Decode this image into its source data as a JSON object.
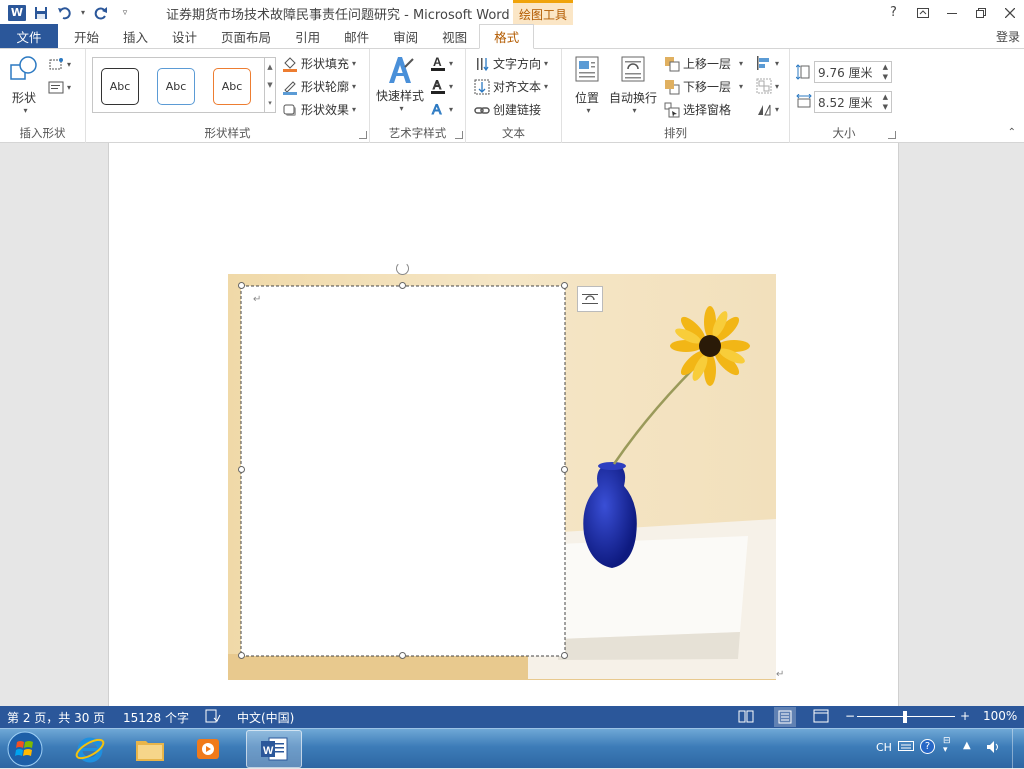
{
  "window": {
    "title": "证券期货市场技术故障民事责任问题研究 - Microsoft Word",
    "context_tab": "绘图工具",
    "login": "登录",
    "help": "?"
  },
  "tabs": [
    {
      "label": "文件"
    },
    {
      "label": "开始"
    },
    {
      "label": "插入"
    },
    {
      "label": "设计"
    },
    {
      "label": "页面布局"
    },
    {
      "label": "引用"
    },
    {
      "label": "邮件"
    },
    {
      "label": "审阅"
    },
    {
      "label": "视图"
    },
    {
      "label": "格式",
      "active": true
    }
  ],
  "ribbon": {
    "insert_shapes": {
      "shapes_label": "形状",
      "group_label": "插入形状"
    },
    "shape_styles": {
      "style_samples": [
        "Abc",
        "Abc",
        "Abc"
      ],
      "fill": "形状填充",
      "outline": "形状轮廓",
      "effects": "形状效果",
      "group_label": "形状样式"
    },
    "wordart": {
      "quick_styles": "快速样式",
      "group_label": "艺术字样式"
    },
    "text": {
      "direction": "文字方向",
      "align": "对齐文本",
      "link": "创建链接",
      "group_label": "文本"
    },
    "arrange": {
      "position": "位置",
      "wrap": "自动换行",
      "forward": "上移一层",
      "backward": "下移一层",
      "selection_pane": "选择窗格",
      "group_label": "排列"
    },
    "size": {
      "height": "9.76 厘米",
      "width": "8.52 厘米",
      "group_label": "大小"
    }
  },
  "document": {
    "paragraph_mark": "↵"
  },
  "status": {
    "page": "第 2 页，共 30 页",
    "words": "15128 个字",
    "language": "中文(中国)",
    "zoom": "100%"
  },
  "taskbar": {
    "tray_lang": "CH"
  },
  "colors": {
    "accent": "#2b579a",
    "context": "#b35b00",
    "taskbar": "#3d7cb8"
  }
}
